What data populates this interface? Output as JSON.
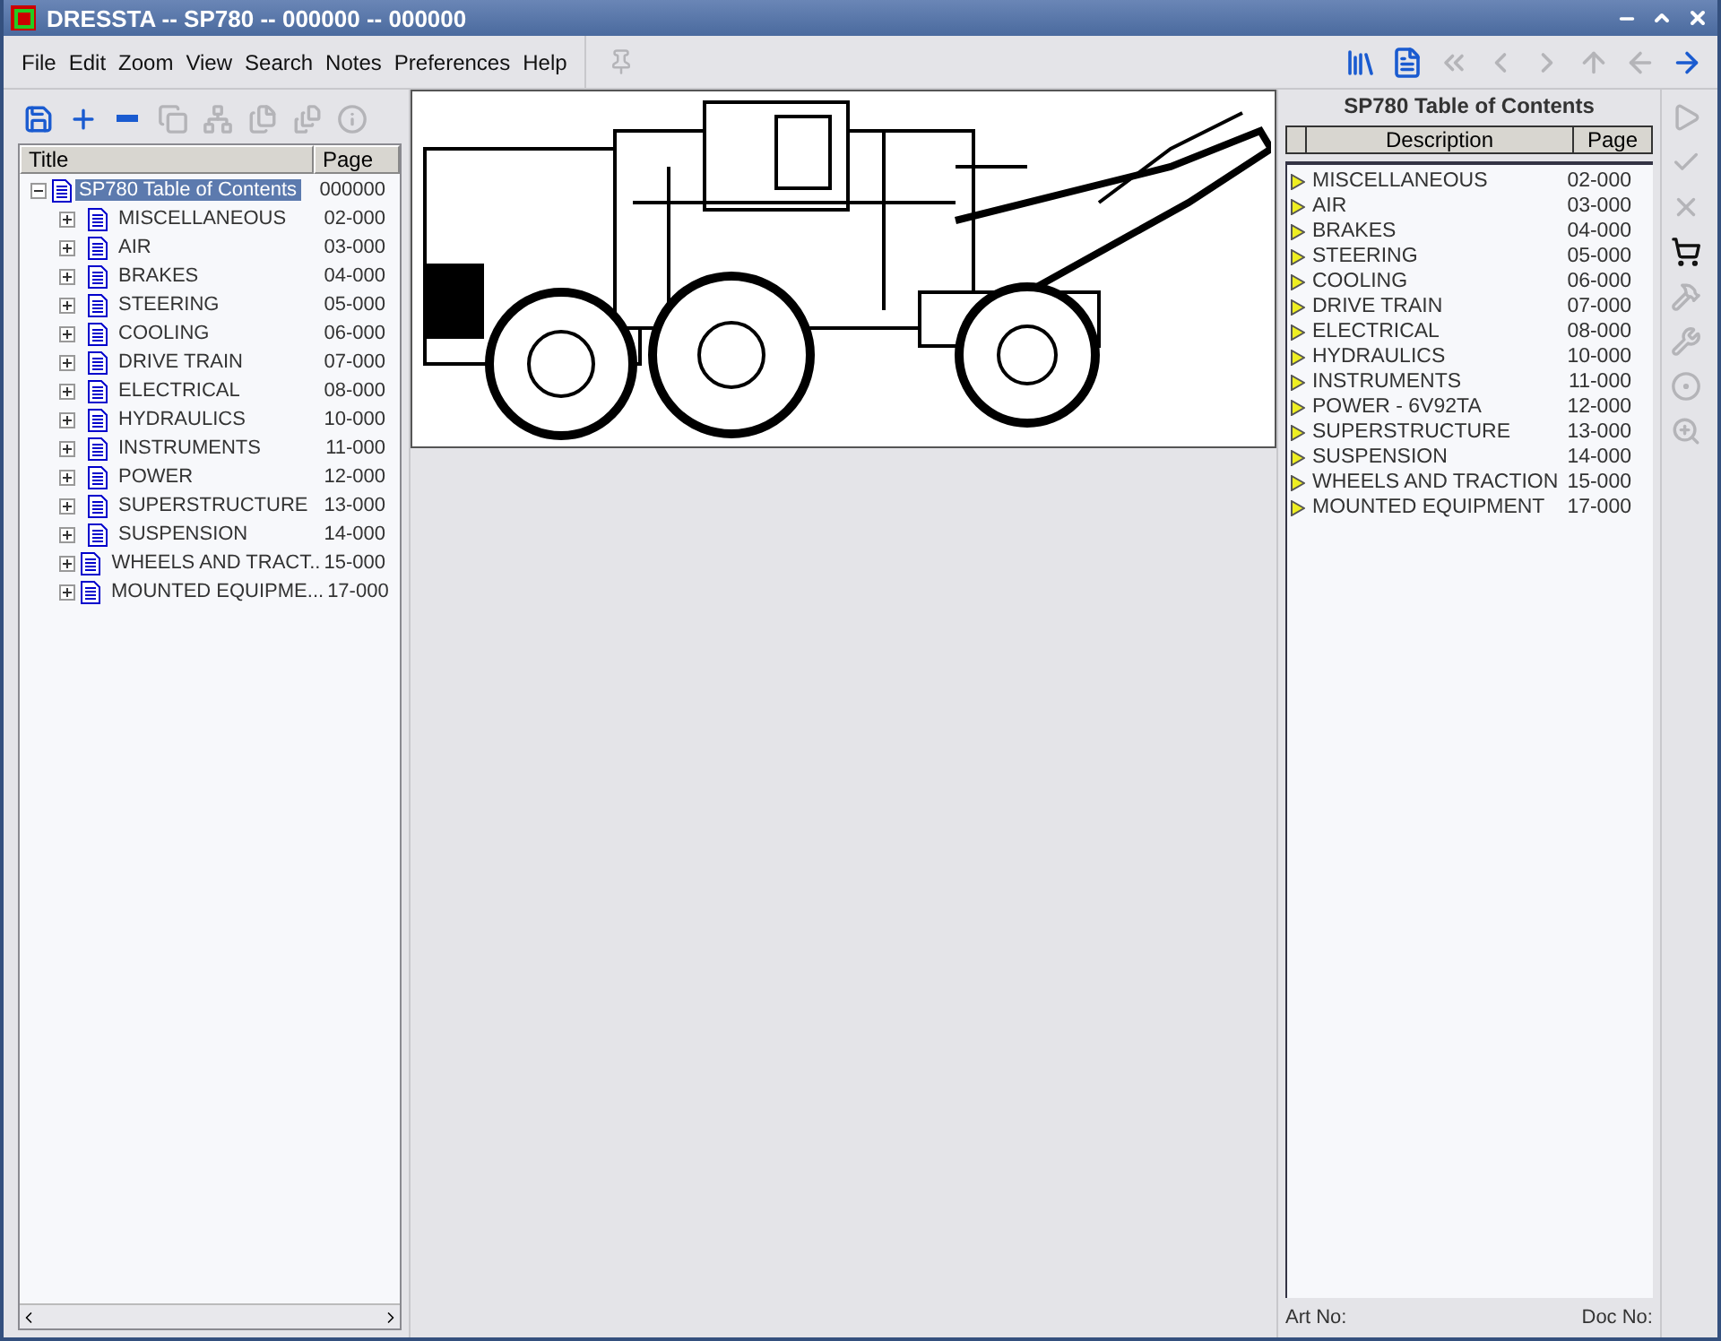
{
  "window": {
    "title": "DRESSTA -- SP780 -- 000000 -- 000000"
  },
  "menu": [
    "File",
    "Edit",
    "Zoom",
    "View",
    "Search",
    "Notes",
    "Preferences",
    "Help"
  ],
  "left_toolbar": [
    {
      "disabled": false
    },
    {
      "disabled": false
    },
    {
      "disabled": false
    },
    {
      "disabled": true
    },
    {
      "disabled": true
    },
    {
      "disabled": true
    },
    {
      "disabled": true
    },
    {
      "disabled": true
    }
  ],
  "nav_toolbar": [
    {
      "disabled": false
    },
    {
      "disabled": false
    },
    {
      "disabled": true
    },
    {
      "disabled": true
    },
    {
      "disabled": true
    },
    {
      "disabled": true
    },
    {
      "disabled": true
    },
    {
      "disabled": false
    }
  ],
  "tree": {
    "columns": [
      "Title",
      "Page"
    ],
    "root": {
      "title": "SP780 Table of Contents",
      "page": "000000",
      "selected": true,
      "expanded": true,
      "children": [
        {
          "title": "MISCELLANEOUS",
          "page": "02-000",
          "selected": false,
          "expanded": false
        },
        {
          "title": "AIR",
          "page": "03-000",
          "selected": false,
          "expanded": false
        },
        {
          "title": "BRAKES",
          "page": "04-000",
          "selected": false,
          "expanded": false
        },
        {
          "title": "STEERING",
          "page": "05-000",
          "selected": false,
          "expanded": false
        },
        {
          "title": "COOLING",
          "page": "06-000",
          "selected": false,
          "expanded": false
        },
        {
          "title": "DRIVE  TRAIN",
          "page": "07-000",
          "selected": false,
          "expanded": false
        },
        {
          "title": "ELECTRICAL",
          "page": "08-000",
          "selected": false,
          "expanded": false
        },
        {
          "title": "HYDRAULICS",
          "page": "10-000",
          "selected": false,
          "expanded": false
        },
        {
          "title": "INSTRUMENTS",
          "page": "11-000",
          "selected": false,
          "expanded": false
        },
        {
          "title": "POWER",
          "page": "12-000",
          "selected": false,
          "expanded": false
        },
        {
          "title": "SUPERSTRUCTURE",
          "page": "13-000",
          "selected": false,
          "expanded": false
        },
        {
          "title": "SUSPENSION",
          "page": "14-000",
          "selected": false,
          "expanded": false
        },
        {
          "title": "WHEELS AND TRACT..",
          "page": "15-000",
          "selected": false,
          "expanded": false
        },
        {
          "title": "MOUNTED EQUIPME...",
          "page": "17-000",
          "selected": false,
          "expanded": false
        }
      ]
    }
  },
  "contents": {
    "title": "SP780 Table of Contents",
    "columns": [
      "Description",
      "Page"
    ],
    "rows": [
      {
        "description": "MISCELLANEOUS",
        "page": "02-000"
      },
      {
        "description": "AIR",
        "page": "03-000"
      },
      {
        "description": "BRAKES",
        "page": "04-000"
      },
      {
        "description": "STEERING",
        "page": "05-000"
      },
      {
        "description": "COOLING",
        "page": "06-000"
      },
      {
        "description": "DRIVE  TRAIN",
        "page": "07-000"
      },
      {
        "description": "ELECTRICAL",
        "page": "08-000"
      },
      {
        "description": "HYDRAULICS",
        "page": "10-000"
      },
      {
        "description": "INSTRUMENTS",
        "page": "11-000"
      },
      {
        "description": "POWER - 6V92TA",
        "page": "12-000"
      },
      {
        "description": "SUPERSTRUCTURE",
        "page": "13-000"
      },
      {
        "description": "SUSPENSION",
        "page": "14-000"
      },
      {
        "description": "WHEELS AND TRACTION",
        "page": "15-000"
      },
      {
        "description": "MOUNTED EQUIPMENT",
        "page": "17-000"
      }
    ],
    "art_no_label": "Art No:",
    "doc_no_label": "Doc No:"
  },
  "side_toolbar": [
    {
      "disabled": true
    },
    {
      "disabled": true
    },
    {
      "disabled": true
    },
    {
      "disabled": false
    },
    {
      "disabled": true
    },
    {
      "disabled": true
    },
    {
      "disabled": true
    },
    {
      "disabled": true
    }
  ]
}
